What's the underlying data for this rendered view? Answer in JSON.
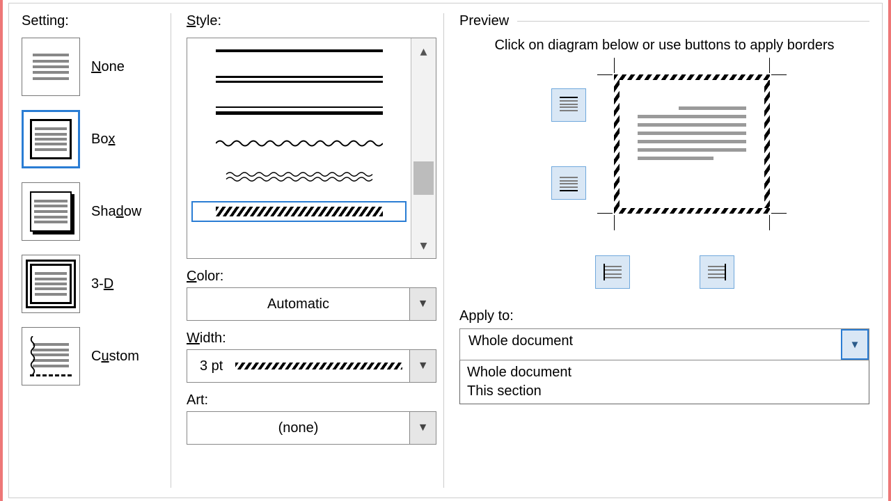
{
  "setting": {
    "label": "Setting:",
    "items": [
      {
        "label": "None",
        "accel": "N"
      },
      {
        "label": "Box",
        "accel": "x"
      },
      {
        "label": "Shadow",
        "accel": "d"
      },
      {
        "label": "3-D",
        "accel": "D"
      },
      {
        "label": "Custom",
        "accel": "u"
      }
    ],
    "selected": "Box"
  },
  "style": {
    "label": "Style:",
    "accel": "S",
    "options": [
      "thick",
      "double",
      "thin-over-thick",
      "wave-single",
      "wave-double",
      "diagonal-hatch"
    ],
    "selected": "diagonal-hatch"
  },
  "color": {
    "label": "Color:",
    "accel": "C",
    "value": "Automatic"
  },
  "width": {
    "label": "Width:",
    "accel": "W",
    "value": "3 pt"
  },
  "art": {
    "label": "Art:",
    "value": "(none)"
  },
  "preview": {
    "label": "Preview",
    "hint": "Click on diagram below or use buttons to apply borders",
    "edges": {
      "top": true,
      "bottom": true,
      "left": true,
      "right": true
    }
  },
  "apply_to": {
    "label": "Apply to:",
    "value": "Whole document",
    "options": [
      "Whole document",
      "This section"
    ]
  }
}
